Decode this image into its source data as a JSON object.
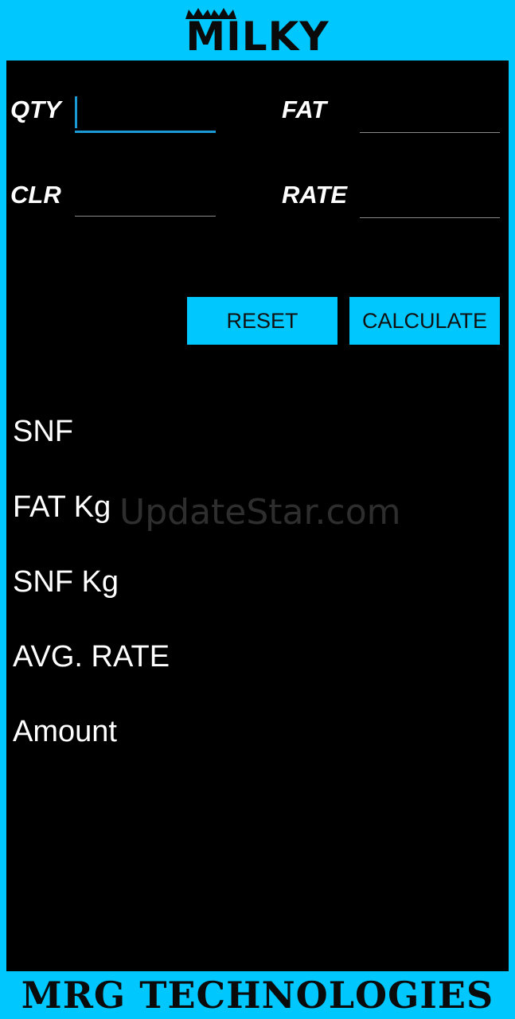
{
  "header": {
    "logo_text": "MILKY"
  },
  "form": {
    "qty": {
      "label": "QTY",
      "value": ""
    },
    "fat": {
      "label": "FAT",
      "value": ""
    },
    "clr": {
      "label": "CLR",
      "value": ""
    },
    "rate": {
      "label": "RATE",
      "value": ""
    }
  },
  "buttons": {
    "reset_label": "RESET",
    "calculate_label": "CALCULATE"
  },
  "results": {
    "snf_label": "SNF",
    "fat_kg_label": "FAT Kg",
    "snf_kg_label": "SNF Kg",
    "avg_rate_label": "AVG. RATE",
    "amount_label": "Amount"
  },
  "watermark": "UpdateStar.com",
  "footer": {
    "text": "MRG TECHNOLOGIES"
  },
  "colors": {
    "accent": "#00c8ff",
    "panel": "#000000",
    "focus": "#1a9bd6"
  }
}
